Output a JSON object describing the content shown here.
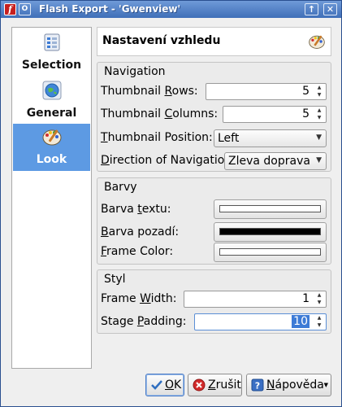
{
  "window": {
    "title": "Flash Export - 'Gwenview'",
    "menu_button": "O",
    "buttons": {
      "minimize": "↑",
      "close": "✕"
    }
  },
  "sidebar": {
    "items": [
      {
        "label": "Selection",
        "icon": "selection-list-icon",
        "selected": false
      },
      {
        "label": "General",
        "icon": "globe-icon",
        "selected": false
      },
      {
        "label": "Look",
        "icon": "paint-palette-icon",
        "selected": true
      }
    ]
  },
  "page": {
    "title": "Nastavení vzhledu",
    "icon": "paint-palette-icon"
  },
  "navigation": {
    "title": "Navigation",
    "thumbnail_rows": {
      "label_pre": "Thumbnail ",
      "label_ul": "R",
      "label_post": "ows:",
      "value": "5"
    },
    "thumbnail_columns": {
      "label_pre": "Thumbnail ",
      "label_ul": "C",
      "label_post": "olumns:",
      "value": "5"
    },
    "thumbnail_position": {
      "label_pre": "",
      "label_ul": "T",
      "label_post": "humbnail Position:",
      "value": "Left"
    },
    "direction": {
      "label_pre": "",
      "label_ul": "D",
      "label_post": "irection of Navigation:",
      "value": "Zleva doprava"
    }
  },
  "barvy": {
    "title": "Barvy",
    "text_color": {
      "label_pre": "Barva ",
      "label_ul": "t",
      "label_post": "extu:",
      "color": "#ffffff"
    },
    "bg_color": {
      "label_pre": "",
      "label_ul": "B",
      "label_post": "arva pozadí:",
      "color": "#000000"
    },
    "frame_color": {
      "label_pre": "",
      "label_ul": "F",
      "label_post": "rame Color:",
      "color": "#ffffff"
    }
  },
  "styl": {
    "title": "Styl",
    "frame_width": {
      "label_pre": "Frame ",
      "label_ul": "W",
      "label_post": "idth:",
      "value": "1"
    },
    "stage_padding": {
      "label_pre": "Stage ",
      "label_ul": "P",
      "label_post": "adding:",
      "value": "10"
    }
  },
  "buttons": {
    "ok": {
      "pre": "",
      "ul": "O",
      "post": "K"
    },
    "cancel": {
      "pre": "",
      "ul": "Z",
      "post": "rušit"
    },
    "help": {
      "pre": "",
      "ul": "N",
      "post": "ápověda"
    }
  },
  "colors": {
    "titlebar": "#4f7fc6",
    "selection": "#5d9ae3",
    "focus": "#3d7bd6"
  }
}
